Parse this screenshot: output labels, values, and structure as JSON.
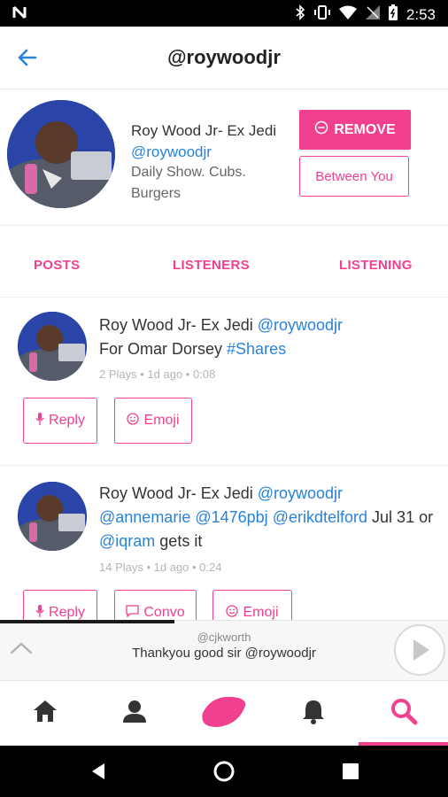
{
  "status_bar": {
    "time": "2:53",
    "left_icon": "n-notification-icon"
  },
  "header": {
    "title": "@roywoodjr",
    "back_icon": "back-arrow-icon"
  },
  "profile": {
    "name": "Roy Wood Jr- Ex Jedi",
    "handle": "@roywoodjr",
    "bio": "Daily Show. Cubs. Burgers",
    "remove_label": "REMOVE",
    "between_label": "Between You"
  },
  "tabs": [
    "POSTS",
    "LISTENERS",
    "LISTENING"
  ],
  "posts": [
    {
      "author": "Roy Wood Jr- Ex Jedi",
      "handle": "@roywoodjr",
      "text_pre": "For Omar Dorsey ",
      "hashtag": "#Shares",
      "meta": "2 Plays • 1d ago • 0:08",
      "actions": {
        "reply": "Reply",
        "emoji": "Emoji"
      }
    },
    {
      "author": "Roy Wood Jr- Ex Jedi",
      "handle": "@roywoodjr",
      "mention1": "@annemarie",
      "mention2": "@1476pbj",
      "mention3": "@erikdtelford",
      "text_mid": "Jul 31 or",
      "mention4": "@iqram",
      "text_end": "gets it",
      "meta": "14 Plays • 1d ago • 0:24",
      "actions": {
        "reply": "Reply",
        "convo": "Convo",
        "emoji": "Emoji"
      }
    }
  ],
  "player": {
    "user": "@cjkworth",
    "text": "Thankyou good sir @roywoodjr",
    "progress": 0.39
  },
  "bottom_nav": [
    "home",
    "profile",
    "record",
    "notifications",
    "search"
  ],
  "colors": {
    "accent": "#f0408f",
    "link": "#2b82d9"
  }
}
